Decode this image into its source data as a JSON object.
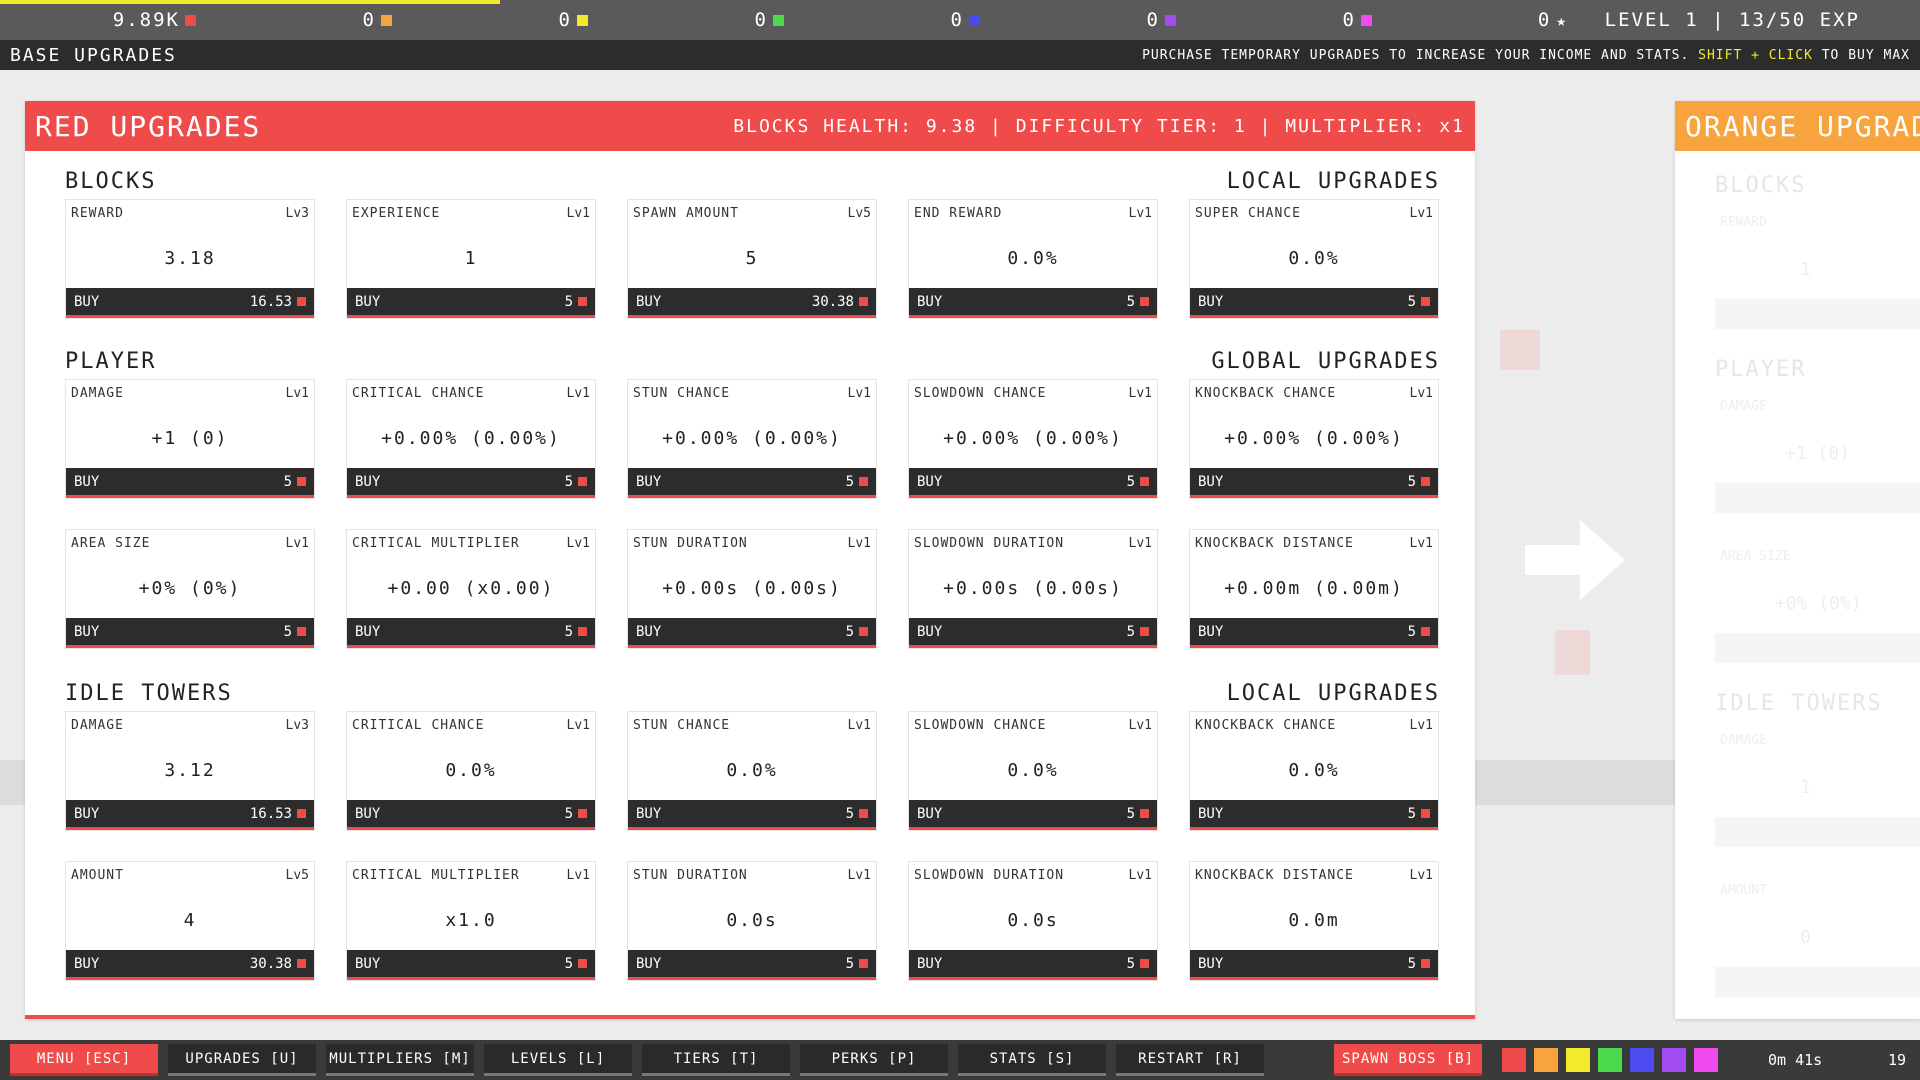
{
  "topbar": {
    "resources": [
      {
        "value": "9.89K",
        "color": "#f04b4b",
        "icon": "square"
      },
      {
        "value": "0",
        "color": "#f7a43e",
        "icon": "square"
      },
      {
        "value": "0",
        "color": "#f2ea2a",
        "icon": "square"
      },
      {
        "value": "0",
        "color": "#4cd94c",
        "icon": "square"
      },
      {
        "value": "0",
        "color": "#4b4bf0",
        "icon": "square"
      },
      {
        "value": "0",
        "color": "#a24bf0",
        "icon": "square"
      },
      {
        "value": "0",
        "color": "#f04bf0",
        "icon": "square"
      },
      {
        "value": "0",
        "color": "#ffffff",
        "icon": "star"
      }
    ],
    "level_text": "LEVEL 1 | 13/50 EXP"
  },
  "subbar": {
    "title": "BASE UPGRADES",
    "hint_a": "PURCHASE TEMPORARY UPGRADES TO INCREASE YOUR INCOME AND STATS. ",
    "hint_b": "SHIFT + CLICK",
    "hint_c": " TO BUY MAX"
  },
  "red_panel": {
    "title": "RED UPGRADES",
    "info": "BLOCKS HEALTH: 9.38 | DIFFICULTY TIER: 1 | MULTIPLIER: x1",
    "sections": [
      {
        "left": "BLOCKS",
        "right": "LOCAL UPGRADES",
        "rows": [
          [
            {
              "name": "REWARD",
              "lv": "Lv3",
              "value": "3.18",
              "buy": "BUY",
              "cost": "16.53"
            },
            {
              "name": "EXPERIENCE",
              "lv": "Lv1",
              "value": "1",
              "buy": "BUY",
              "cost": "5"
            },
            {
              "name": "SPAWN AMOUNT",
              "lv": "Lv5",
              "value": "5",
              "buy": "BUY",
              "cost": "30.38"
            },
            {
              "name": "END REWARD",
              "lv": "Lv1",
              "value": "0.0%",
              "buy": "BUY",
              "cost": "5"
            },
            {
              "name": "SUPER CHANCE",
              "lv": "Lv1",
              "value": "0.0%",
              "buy": "BUY",
              "cost": "5"
            }
          ]
        ]
      },
      {
        "left": "PLAYER",
        "right": "GLOBAL UPGRADES",
        "rows": [
          [
            {
              "name": "DAMAGE",
              "lv": "Lv1",
              "value": "+1 (0)",
              "buy": "BUY",
              "cost": "5"
            },
            {
              "name": "CRITICAL CHANCE",
              "lv": "Lv1",
              "value": "+0.00% (0.00%)",
              "buy": "BUY",
              "cost": "5"
            },
            {
              "name": "STUN CHANCE",
              "lv": "Lv1",
              "value": "+0.00% (0.00%)",
              "buy": "BUY",
              "cost": "5"
            },
            {
              "name": "SLOWDOWN CHANCE",
              "lv": "Lv1",
              "value": "+0.00% (0.00%)",
              "buy": "BUY",
              "cost": "5"
            },
            {
              "name": "KNOCKBACK CHANCE",
              "lv": "Lv1",
              "value": "+0.00% (0.00%)",
              "buy": "BUY",
              "cost": "5"
            }
          ],
          [
            {
              "name": "AREA SIZE",
              "lv": "Lv1",
              "value": "+0% (0%)",
              "buy": "BUY",
              "cost": "5"
            },
            {
              "name": "CRITICAL MULTIPLIER",
              "lv": "Lv1",
              "value": "+0.00 (x0.00)",
              "buy": "BUY",
              "cost": "5"
            },
            {
              "name": "STUN DURATION",
              "lv": "Lv1",
              "value": "+0.00s (0.00s)",
              "buy": "BUY",
              "cost": "5"
            },
            {
              "name": "SLOWDOWN DURATION",
              "lv": "Lv1",
              "value": "+0.00s (0.00s)",
              "buy": "BUY",
              "cost": "5"
            },
            {
              "name": "KNOCKBACK DISTANCE",
              "lv": "Lv1",
              "value": "+0.00m (0.00m)",
              "buy": "BUY",
              "cost": "5"
            }
          ]
        ]
      },
      {
        "left": "IDLE TOWERS",
        "right": "LOCAL UPGRADES",
        "rows": [
          [
            {
              "name": "DAMAGE",
              "lv": "Lv3",
              "value": "3.12",
              "buy": "BUY",
              "cost": "16.53"
            },
            {
              "name": "CRITICAL CHANCE",
              "lv": "Lv1",
              "value": "0.0%",
              "buy": "BUY",
              "cost": "5"
            },
            {
              "name": "STUN CHANCE",
              "lv": "Lv1",
              "value": "0.0%",
              "buy": "BUY",
              "cost": "5"
            },
            {
              "name": "SLOWDOWN CHANCE",
              "lv": "Lv1",
              "value": "0.0%",
              "buy": "BUY",
              "cost": "5"
            },
            {
              "name": "KNOCKBACK CHANCE",
              "lv": "Lv1",
              "value": "0.0%",
              "buy": "BUY",
              "cost": "5"
            }
          ],
          [
            {
              "name": "AMOUNT",
              "lv": "Lv5",
              "value": "4",
              "buy": "BUY",
              "cost": "30.38"
            },
            {
              "name": "CRITICAL MULTIPLIER",
              "lv": "Lv1",
              "value": "x1.0",
              "buy": "BUY",
              "cost": "5"
            },
            {
              "name": "STUN DURATION",
              "lv": "Lv1",
              "value": "0.0s",
              "buy": "BUY",
              "cost": "5"
            },
            {
              "name": "SLOWDOWN DURATION",
              "lv": "Lv1",
              "value": "0.0s",
              "buy": "BUY",
              "cost": "5"
            },
            {
              "name": "KNOCKBACK DISTANCE",
              "lv": "Lv1",
              "value": "0.0m",
              "buy": "BUY",
              "cost": "5"
            }
          ]
        ]
      }
    ]
  },
  "orange_panel": {
    "title": "ORANGE UPGRAD",
    "ghost": {
      "blocks": "BLOCKS",
      "reward": "REWARD",
      "reward_value": "1",
      "player": "PLAYER",
      "damage": "DAMAGE",
      "damage_value": "+1 (0)",
      "area": "AREA SIZE",
      "area_value": "+0% (0%)",
      "towers": "IDLE TOWERS",
      "t_damage": "DAMAGE",
      "t_damage_value": "1",
      "t_amount": "AMOUNT",
      "t_amount_value": "0"
    }
  },
  "bottombar": {
    "buttons": [
      {
        "label": "MENU [ESC]"
      },
      {
        "label": "UPGRADES [U]"
      },
      {
        "label": "MULTIPLIERS [M]"
      },
      {
        "label": "LEVELS [L]"
      },
      {
        "label": "TIERS [T]"
      },
      {
        "label": "PERKS [P]"
      },
      {
        "label": "STATS [S]"
      },
      {
        "label": "RESTART [R]"
      }
    ],
    "boss": "SPAWN BOSS [B]",
    "swatches": [
      "#f04b4b",
      "#f7a43e",
      "#f2ea2a",
      "#4cd94c",
      "#4b4bf0",
      "#a24bf0",
      "#f04bf0"
    ],
    "timer": "0m 41s",
    "counter": "19"
  }
}
